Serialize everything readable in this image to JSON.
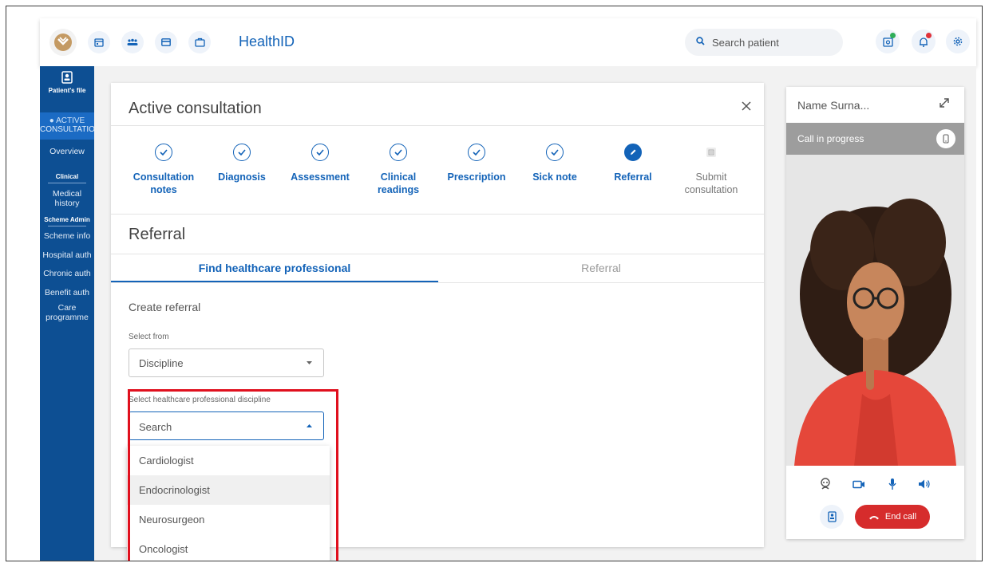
{
  "app": {
    "title": "HealthID"
  },
  "topbar": {
    "search_placeholder": "Search patient",
    "nav_icons": [
      "calendar-icon",
      "people-icon",
      "card-icon",
      "briefcase-icon"
    ],
    "action_icons": [
      "device-icon",
      "bell-icon",
      "gear-icon"
    ]
  },
  "sidebar": {
    "patient_file": "Patient's file",
    "active_line1": "● ACTIVE",
    "active_line2": "CONSULTATION",
    "overview": "Overview",
    "clinical_head": "Clinical",
    "medical_history": "Medical history",
    "scheme_head": "Scheme Admin",
    "scheme_items": [
      "Scheme info",
      "Hospital auth",
      "Chronic auth",
      "Benefit auth",
      "Care programme"
    ]
  },
  "consultation": {
    "title": "Active consultation",
    "steps": [
      {
        "line1": "Consultation",
        "line2": "notes",
        "state": "done"
      },
      {
        "line1": "Diagnosis",
        "line2": "",
        "state": "done"
      },
      {
        "line1": "Assessment",
        "line2": "",
        "state": "done"
      },
      {
        "line1": "Clinical",
        "line2": "readings",
        "state": "done"
      },
      {
        "line1": "Prescription",
        "line2": "",
        "state": "done"
      },
      {
        "line1": "Sick note",
        "line2": "",
        "state": "done"
      },
      {
        "line1": "Referral",
        "line2": "",
        "state": "current"
      },
      {
        "line1": "Submit",
        "line2": "consultation",
        "state": "pending"
      }
    ],
    "section_title": "Referral",
    "tabs": [
      "Find healthcare professional",
      "Referral"
    ],
    "create_label": "Create referral",
    "select_from_label": "Select from",
    "select_from_value": "Discipline",
    "discipline_label": "Select healthcare professional discipline",
    "discipline_placeholder": "Search",
    "discipline_options": [
      "Cardiologist",
      "Endocrinologist",
      "Neurosurgeon",
      "Oncologist"
    ],
    "highlighted_option": "Endocrinologist"
  },
  "video": {
    "name": "Name Surna...",
    "status": "Call in progress",
    "end_call": "End call"
  },
  "colors": {
    "primary": "#1363b8",
    "sidebar": "#0d4f93",
    "end_call": "#d62c2c",
    "highlight_box": "#e0101e"
  }
}
